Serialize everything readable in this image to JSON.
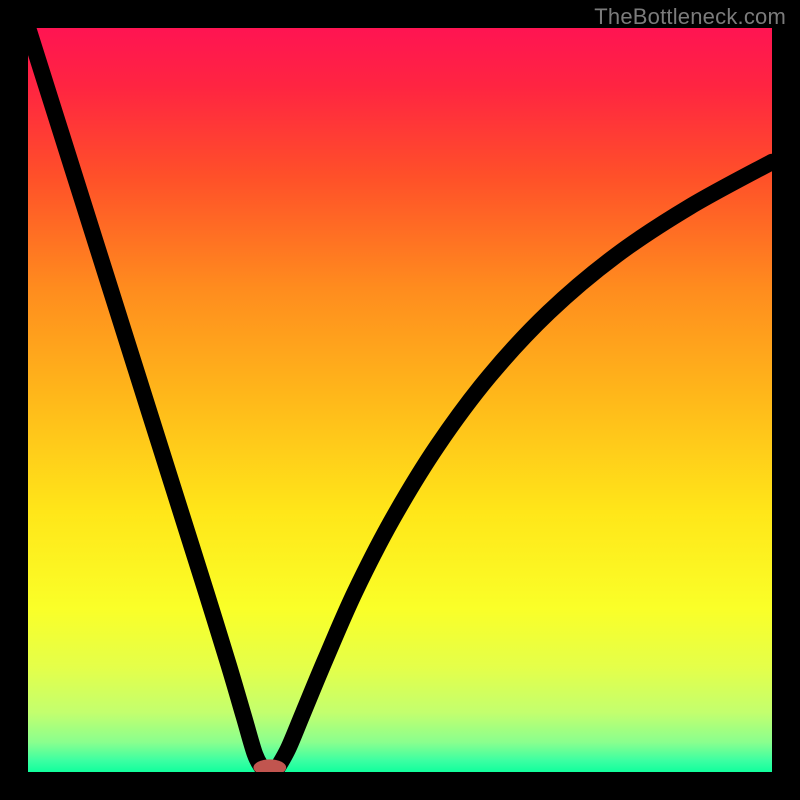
{
  "watermark": "TheBottleneck.com",
  "chart_data": {
    "type": "line",
    "title": "",
    "xlabel": "",
    "ylabel": "",
    "xlim": [
      0,
      100
    ],
    "ylim": [
      0,
      100
    ],
    "grid": false,
    "legend": false,
    "gradient_stops": [
      {
        "pos": 0,
        "color": "#ff1452"
      },
      {
        "pos": 0.08,
        "color": "#ff2541"
      },
      {
        "pos": 0.2,
        "color": "#ff5029"
      },
      {
        "pos": 0.35,
        "color": "#ff8c1e"
      },
      {
        "pos": 0.5,
        "color": "#ffb91a"
      },
      {
        "pos": 0.65,
        "color": "#ffe619"
      },
      {
        "pos": 0.78,
        "color": "#faff28"
      },
      {
        "pos": 0.86,
        "color": "#e4ff4a"
      },
      {
        "pos": 0.92,
        "color": "#c3ff6e"
      },
      {
        "pos": 0.96,
        "color": "#8aff8e"
      },
      {
        "pos": 0.985,
        "color": "#3bffa2"
      },
      {
        "pos": 1.0,
        "color": "#11ff9d"
      }
    ],
    "series": [
      {
        "name": "left-branch",
        "x": [
          0,
          3,
          6,
          9,
          12,
          15,
          18,
          21,
          24,
          27,
          29,
          30.5,
          31.5
        ],
        "y": [
          100,
          90.5,
          81,
          71.5,
          62,
          52.5,
          43,
          33.5,
          24,
          14.3,
          7.5,
          2.4,
          0.5
        ]
      },
      {
        "name": "right-branch",
        "x": [
          33.5,
          35,
          37,
          40,
          44,
          49,
          55,
          62,
          70,
          79,
          89,
          100
        ],
        "y": [
          0.5,
          3.2,
          8.0,
          15.2,
          24.3,
          34.0,
          43.8,
          53.2,
          61.8,
          69.4,
          76.0,
          82.0
        ]
      }
    ],
    "marker": {
      "x": 32.5,
      "y": 0.6,
      "rx": 2.2,
      "ry": 1.1,
      "color": "#c1554f"
    }
  }
}
